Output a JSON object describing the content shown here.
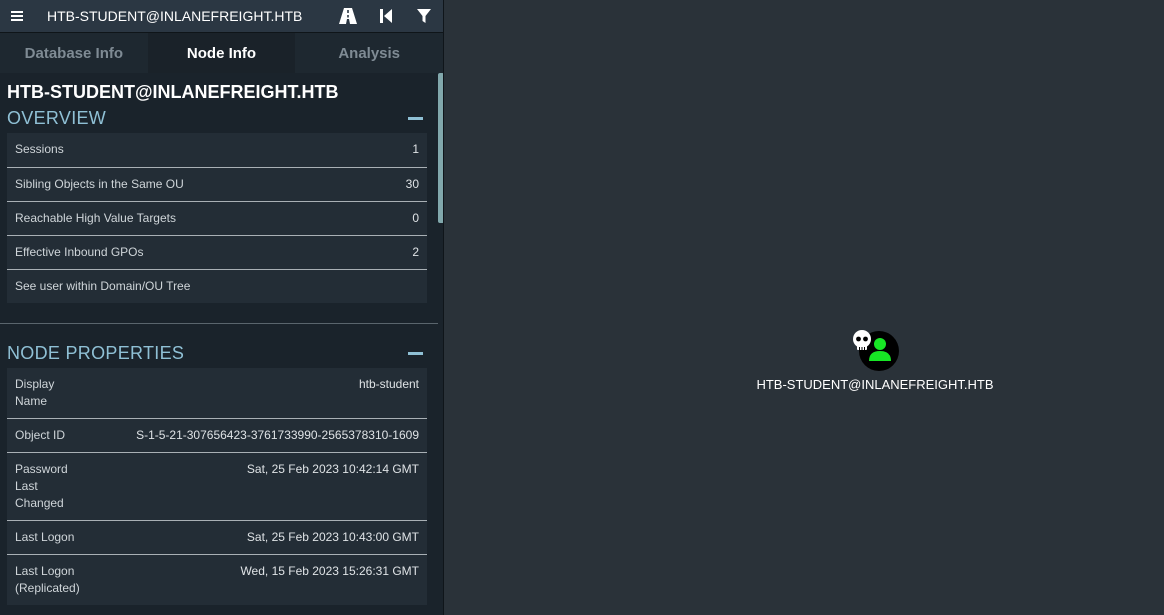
{
  "topbar": {
    "search_value": "HTB-STUDENT@INLANEFREIGHT.HTB",
    "icons": [
      "menu-icon",
      "pathfinding-icon",
      "back-icon",
      "filter-icon"
    ]
  },
  "tabs": [
    {
      "label": "Database Info",
      "active": false
    },
    {
      "label": "Node Info",
      "active": true
    },
    {
      "label": "Analysis",
      "active": false
    }
  ],
  "node_info": {
    "title": "HTB-STUDENT@INLANEFREIGHT.HTB",
    "overview": {
      "heading": "OVERVIEW",
      "rows": [
        {
          "label": "Sessions",
          "value": "1"
        },
        {
          "label": "Sibling Objects in the Same OU",
          "value": "30"
        },
        {
          "label": "Reachable High Value Targets",
          "value": "0"
        },
        {
          "label": "Effective Inbound GPOs",
          "value": "2"
        },
        {
          "label": "See user within Domain/OU Tree",
          "value": ""
        }
      ]
    },
    "node_properties": {
      "heading": "NODE PROPERTIES",
      "rows": [
        {
          "label": "Display Name",
          "value": "htb-student"
        },
        {
          "label": "Object ID",
          "value": "S-1-5-21-307656423-3761733990-2565378310-1609"
        },
        {
          "label": "Password Last Changed",
          "value": "Sat, 25 Feb 2023 10:42:14 GMT"
        },
        {
          "label": "Last Logon",
          "value": "Sat, 25 Feb 2023 10:43:00 GMT"
        },
        {
          "label": "Last Logon (Replicated)",
          "value": "Wed, 15 Feb 2023 15:26:31 GMT"
        }
      ]
    }
  },
  "graph": {
    "node_label": "HTB-STUDENT@INLANEFREIGHT.HTB",
    "node_icon": "user-icon",
    "owned_marker": "skull-icon",
    "colors": {
      "background": "#2a3239",
      "user_icon": "#17e625",
      "node_circle": "#000000"
    }
  }
}
